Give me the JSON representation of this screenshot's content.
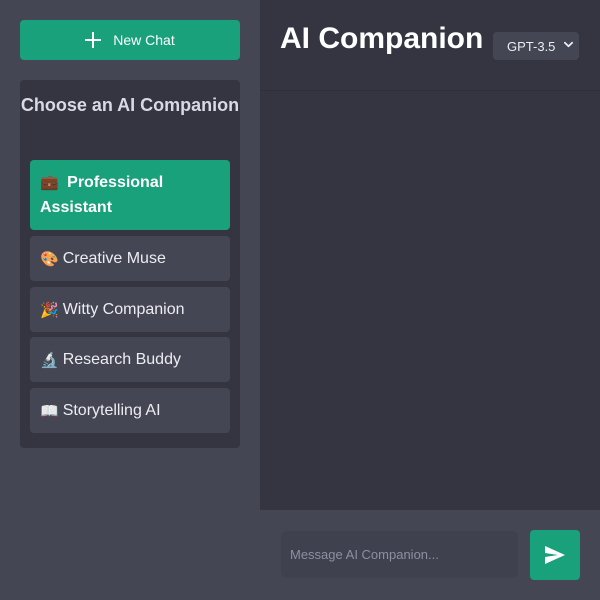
{
  "sidebar": {
    "new_chat_label": "New Chat",
    "panel_title": "Choose an AI Companion",
    "companions": [
      {
        "emoji": "💼",
        "label": "Professional Assistant",
        "active": true
      },
      {
        "emoji": "🎨",
        "label": "Creative Muse",
        "active": false
      },
      {
        "emoji": "🎉",
        "label": "Witty Companion",
        "active": false
      },
      {
        "emoji": "🔬",
        "label": "Research Buddy",
        "active": false
      },
      {
        "emoji": "📖",
        "label": "Storytelling AI",
        "active": false
      }
    ]
  },
  "header": {
    "title": "AI Companion",
    "model_selected": "GPT-3.5"
  },
  "composer": {
    "placeholder": "Message AI Companion..."
  },
  "colors": {
    "accent": "#19a17c",
    "sidebar_bg": "#444654",
    "main_bg": "#343541"
  },
  "icons": {
    "new_chat": "plus-icon",
    "model_dropdown": "chevron-down-icon",
    "send": "send-icon"
  }
}
